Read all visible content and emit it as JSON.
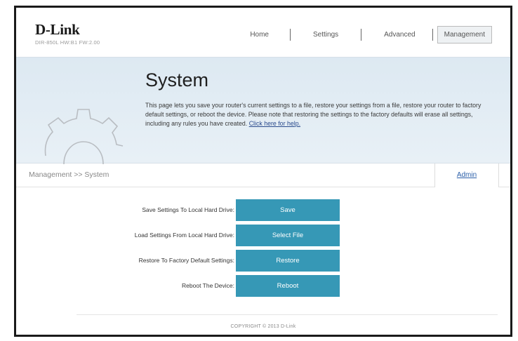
{
  "header": {
    "brand": "D-Link",
    "model_info": "DIR-850L   HW:B1   FW:2.00",
    "nav": [
      {
        "label": "Home"
      },
      {
        "label": "Settings"
      },
      {
        "label": "Advanced"
      },
      {
        "label": "Management"
      }
    ]
  },
  "banner": {
    "title": "System",
    "description": "This page lets you save your router's current settings to a file, restore your settings from a file, restore your router to factory default settings, or reboot the device. Please note that restoring the settings to the factory defaults will erase all settings, including any rules you have created. ",
    "help_link": "Click here for help."
  },
  "breadcrumb": {
    "path": "Management >> System",
    "tab": "Admin"
  },
  "actions": [
    {
      "label": "Save Settings To Local Hard Drive:",
      "button": "Save"
    },
    {
      "label": "Load Settings From Local Hard Drive:",
      "button": "Select File"
    },
    {
      "label": "Restore To Factory Default Settings:",
      "button": "Restore"
    },
    {
      "label": "Reboot The Device:",
      "button": "Reboot"
    }
  ],
  "footer": {
    "copyright": "COPYRIGHT © 2013 D-Link"
  },
  "colors": {
    "accent_button": "#3698b6",
    "banner_bg": "#dde9f2",
    "link": "#2a4b8d"
  }
}
